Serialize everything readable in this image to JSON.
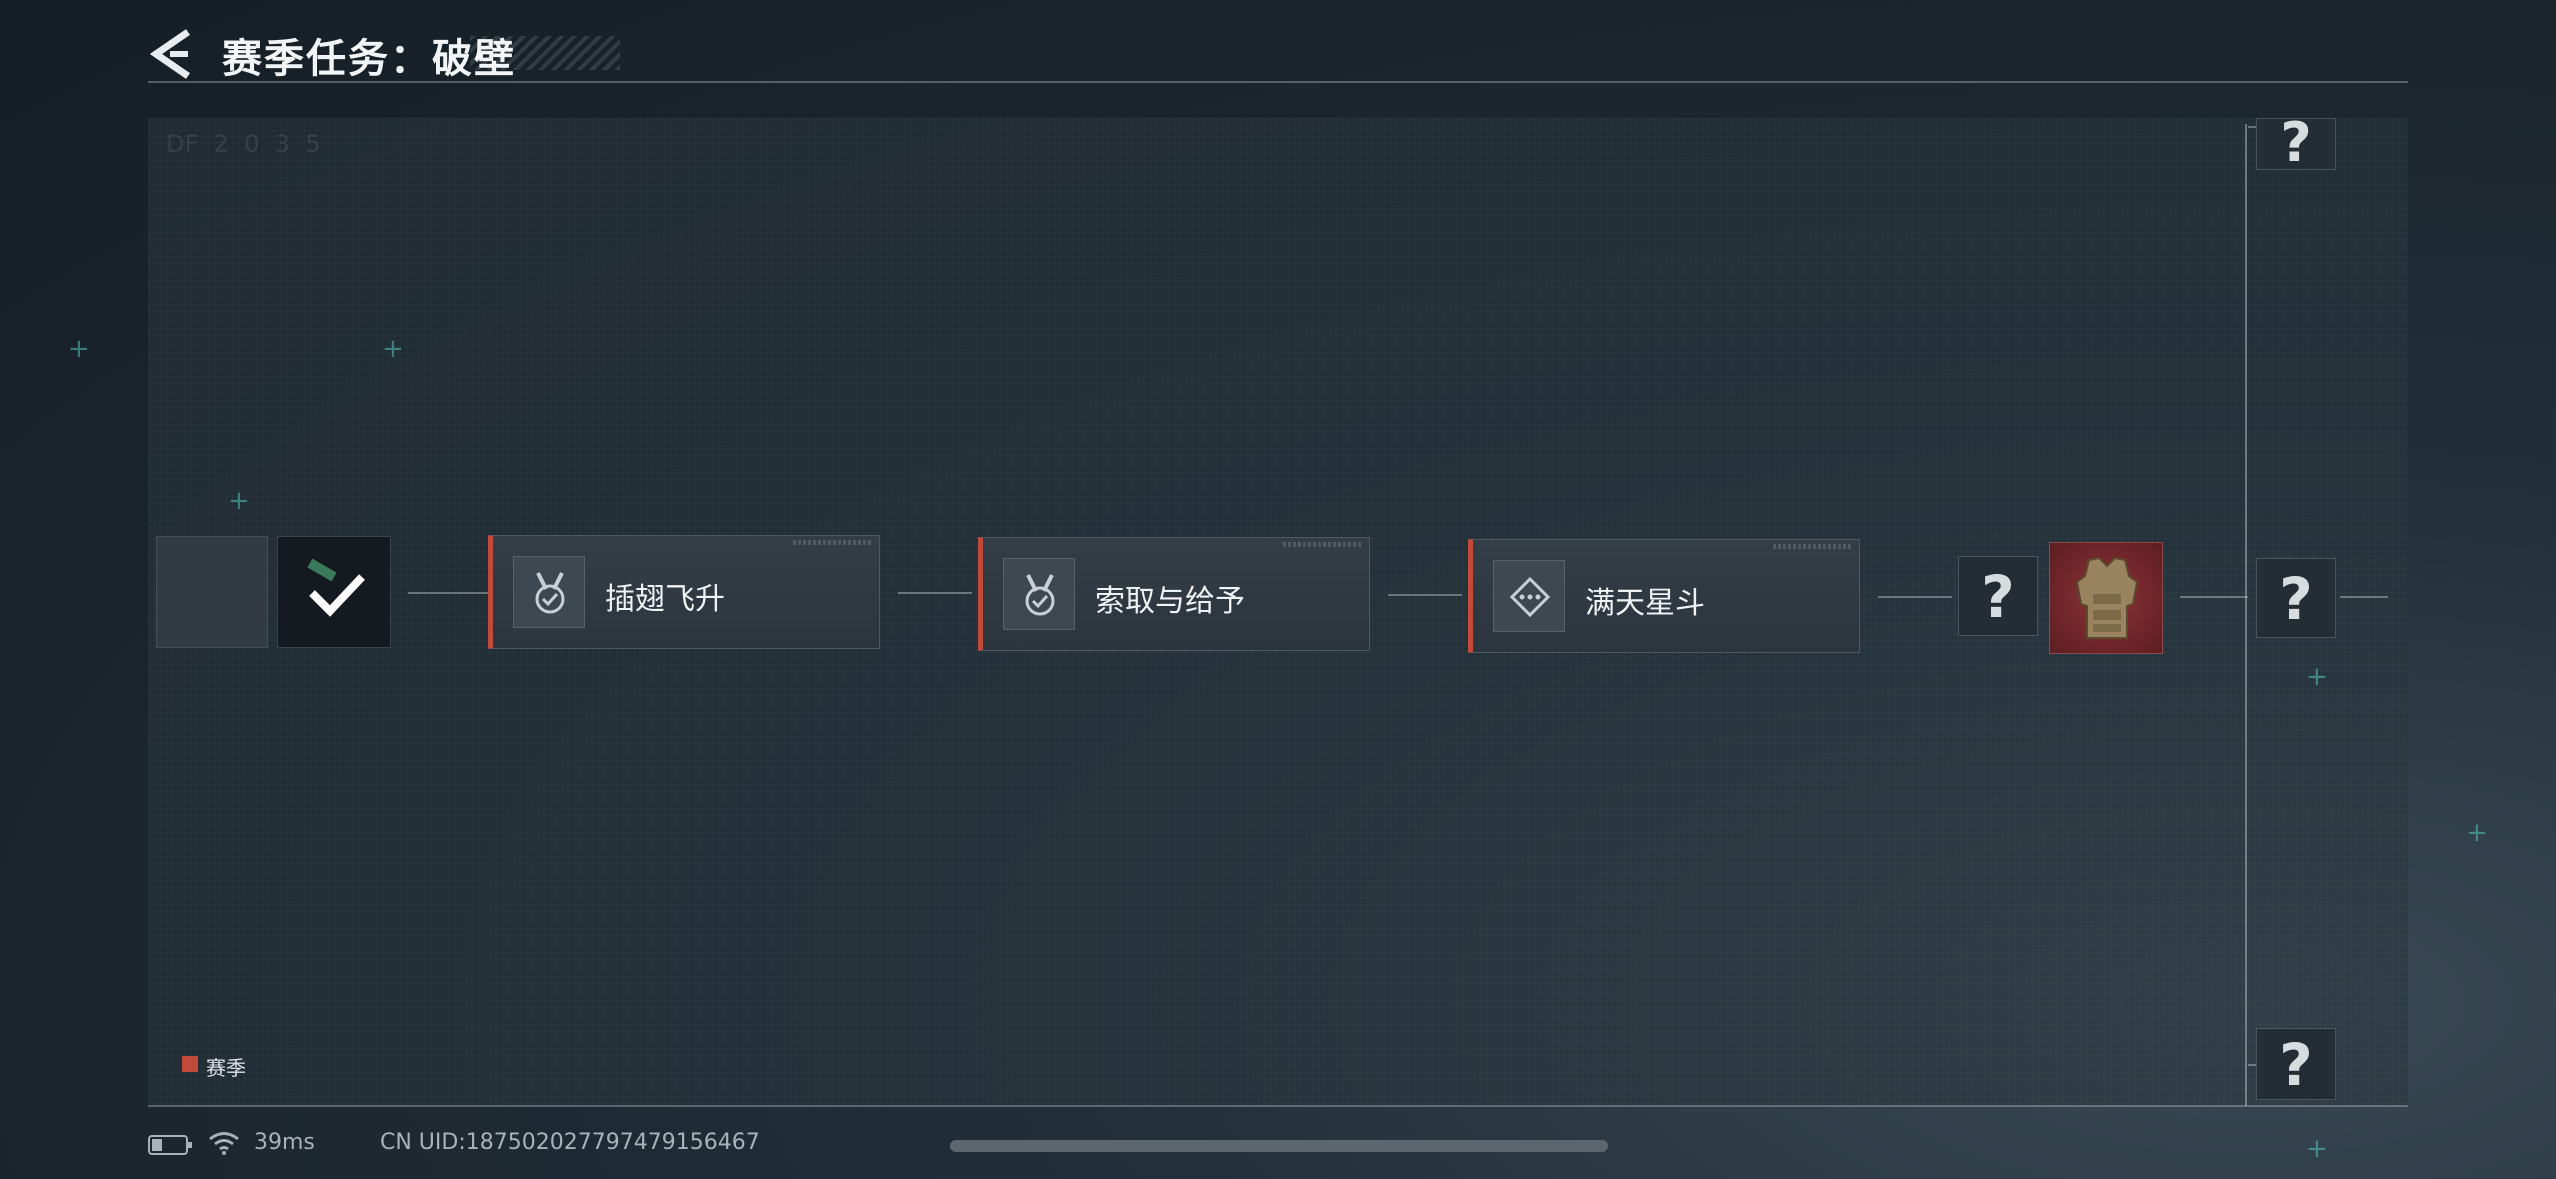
{
  "header": {
    "title": "赛季任务：破壁",
    "back_icon": "chevron-left-icon"
  },
  "chain": {
    "start_tiles": [
      {
        "name": "empty-slot"
      },
      {
        "name": "completed-task",
        "icon": "checkmark-icon"
      }
    ],
    "tasks": [
      {
        "label": "插翅飞升",
        "icon": "medal-check-icon"
      },
      {
        "label": "索取与给予",
        "icon": "medal-check-icon"
      },
      {
        "label": "满天星斗",
        "icon": "diamond-dots-icon"
      }
    ],
    "unknown_mark": "?",
    "reward_icon": "armor-vest-icon"
  },
  "legend": {
    "label": "赛季",
    "color": "#c14a3a"
  },
  "status_bar": {
    "battery_icon": "battery-icon",
    "wifi_icon": "wifi-icon",
    "ping": "39ms",
    "uid": "CN UID:187502027797479156467"
  },
  "colors": {
    "accent": "#c14a3a",
    "background": "#1b252d"
  }
}
